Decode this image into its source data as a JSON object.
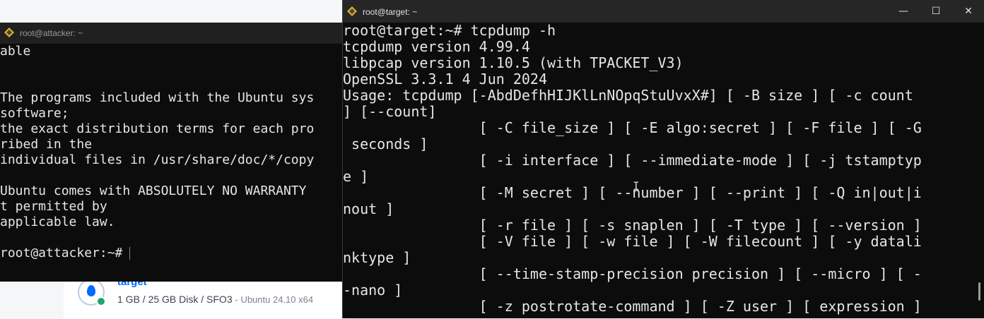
{
  "background": {
    "droplet": {
      "name": "target",
      "specs": "1 GB / 25 GB Disk / SFO3",
      "os": "- Ubuntu 24.10 x64",
      "status_color": "#1ea672",
      "brand_color": "#0069ff"
    }
  },
  "attacker_window": {
    "title": "root@attacker: ~",
    "icon": "linux-tux-icon",
    "lines": [
      "able",
      "",
      "",
      "The programs included with the Ubuntu sys",
      "software;",
      "the exact distribution terms for each pro",
      "ribed in the",
      "individual files in /usr/share/doc/*/copy",
      "",
      "Ubuntu comes with ABSOLUTELY NO WARRANTY",
      "t permitted by",
      "applicable law.",
      "",
      "root@attacker:~#"
    ]
  },
  "target_window": {
    "title": "root@target: ~",
    "icon": "linux-tux-icon",
    "controls": {
      "minimize": "—",
      "maximize": "☐",
      "close": "✕"
    },
    "lines": [
      "root@target:~# tcpdump -h",
      "tcpdump version 4.99.4",
      "libpcap version 1.10.5 (with TPACKET_V3)",
      "OpenSSL 3.3.1 4 Jun 2024",
      "Usage: tcpdump [-AbdDefhHIJKlLnNOpqStuUvxX#] [ -B size ] [ -c count",
      "] [--count]",
      "                [ -C file_size ] [ -E algo:secret ] [ -F file ] [ -G",
      " seconds ]",
      "                [ -i interface ] [ --immediate-mode ] [ -j tstamptyp",
      "e ]",
      "                [ -M secret ] [ --number ] [ --print ] [ -Q in|out|i",
      "nout ]",
      "                [ -r file ] [ -s snaplen ] [ -T type ] [ --version ]",
      "                [ -V file ] [ -w file ] [ -W filecount ] [ -y datali",
      "nktype ]",
      "                [ --time-stamp-precision precision ] [ --micro ] [ -",
      "-nano ]",
      "                [ -z postrotate-command ] [ -Z user ] [ expression ]"
    ]
  }
}
